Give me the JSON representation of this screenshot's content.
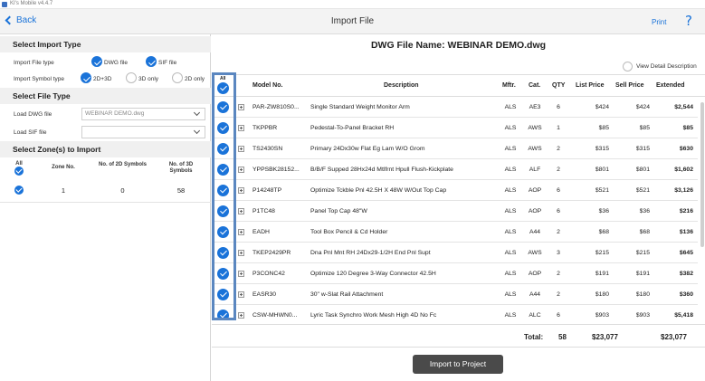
{
  "os": {
    "title": "KI's Mobile v4.4.7"
  },
  "nav": {
    "back_label": "Back",
    "title": "Import File",
    "print_label": "Print",
    "help_label": "?"
  },
  "import_type": {
    "header": "Select Import Type",
    "file_type_label": "Import File type",
    "file_type_options": [
      "DWG file",
      "SIF file"
    ],
    "symbol_type_label": "Import Symbol type",
    "symbol_type_options": [
      "2D+3D",
      "3D only",
      "2D only"
    ],
    "symbol_type_selected": "2D+3D"
  },
  "file_type": {
    "header": "Select File Type",
    "dwg_label": "Load DWG file",
    "dwg_value": "WEBINAR DEMO.dwg",
    "sif_label": "Load SIF file",
    "sif_value": ""
  },
  "zones": {
    "header": "Select Zone(s) to Import",
    "all_label": "All",
    "col_zone": "Zone No.",
    "col_2d": "No. of 2D Symbols",
    "col_3d": "No. of 3D Symbols",
    "rows": [
      {
        "zone": "1",
        "n2d": "0",
        "n3d": "58"
      }
    ]
  },
  "main": {
    "file_title": "DWG File Name: WEBINAR DEMO.dwg",
    "view_detail_label": "View Detail Description",
    "all_label": "All",
    "columns": {
      "model": "Model No.",
      "description": "Description",
      "mfr": "Mftr.",
      "cat": "Cat.",
      "qty": "QTY",
      "list_price": "List Price",
      "sell_price": "Sell Price",
      "extended": "Extended"
    },
    "rows": [
      {
        "model": "PAR-ZW810S0...",
        "description": "Single Standard Weight Monitor Arm",
        "mfr": "ALS",
        "cat": "AE3",
        "qty": "6",
        "list": "$424",
        "sell": "$424",
        "ext": "$2,544"
      },
      {
        "model": "TKPPBR",
        "description": "Pedestal-To-Panel Bracket RH",
        "mfr": "ALS",
        "cat": "AWS",
        "qty": "1",
        "list": "$85",
        "sell": "$85",
        "ext": "$85"
      },
      {
        "model": "TS2430SN",
        "description": "Primary 24Dx30w Flat Eg Lam W/O Grom",
        "mfr": "ALS",
        "cat": "AWS",
        "qty": "2",
        "list": "$315",
        "sell": "$315",
        "ext": "$630"
      },
      {
        "model": "YPPSBK28152...",
        "description": "B/B/F Supped 28Hx24d Mtlfrnt Hpull Flush-Kickplate",
        "mfr": "ALS",
        "cat": "ALF",
        "qty": "2",
        "list": "$801",
        "sell": "$801",
        "ext": "$1,602"
      },
      {
        "model": "P14248TP",
        "description": "Optimize Tckble Pnl 42.5H X 48W W/Out Top Cap",
        "mfr": "ALS",
        "cat": "AOP",
        "qty": "6",
        "list": "$521",
        "sell": "$521",
        "ext": "$3,126"
      },
      {
        "model": "P1TC48",
        "description": "Panel Top Cap 48\"W",
        "mfr": "ALS",
        "cat": "AOP",
        "qty": "6",
        "list": "$36",
        "sell": "$36",
        "ext": "$216"
      },
      {
        "model": "EADH",
        "description": "Tool Box Pencil & Cd Holder",
        "mfr": "ALS",
        "cat": "A44",
        "qty": "2",
        "list": "$68",
        "sell": "$68",
        "ext": "$136"
      },
      {
        "model": "TKEP2429PR",
        "description": "Dna Pnl Mnt RH 24Dx29-1/2H End Pnl Supt",
        "mfr": "ALS",
        "cat": "AWS",
        "qty": "3",
        "list": "$215",
        "sell": "$215",
        "ext": "$645"
      },
      {
        "model": "P3CONC42",
        "description": "Optimize 120 Degree 3-Way Connector 42.5H",
        "mfr": "ALS",
        "cat": "AOP",
        "qty": "2",
        "list": "$191",
        "sell": "$191",
        "ext": "$382"
      },
      {
        "model": "EASR30",
        "description": "30\" w-Slat Rail Attachment",
        "mfr": "ALS",
        "cat": "A44",
        "qty": "2",
        "list": "$180",
        "sell": "$180",
        "ext": "$360"
      },
      {
        "model": "CSW-MHWN0...",
        "description": "Lyric Task Synchro Work Mesh High 4D No Fc",
        "mfr": "ALS",
        "cat": "ALC",
        "qty": "6",
        "list": "$903",
        "sell": "$903",
        "ext": "$5,418"
      }
    ],
    "totals": {
      "label": "Total:",
      "qty": "58",
      "list": "$23,077",
      "ext": "$23,077"
    },
    "import_button": "Import to Project"
  },
  "colors": {
    "accent": "#1a73d9",
    "highlight_border": "#5b87c0",
    "button_bg": "#4a4a4a"
  }
}
